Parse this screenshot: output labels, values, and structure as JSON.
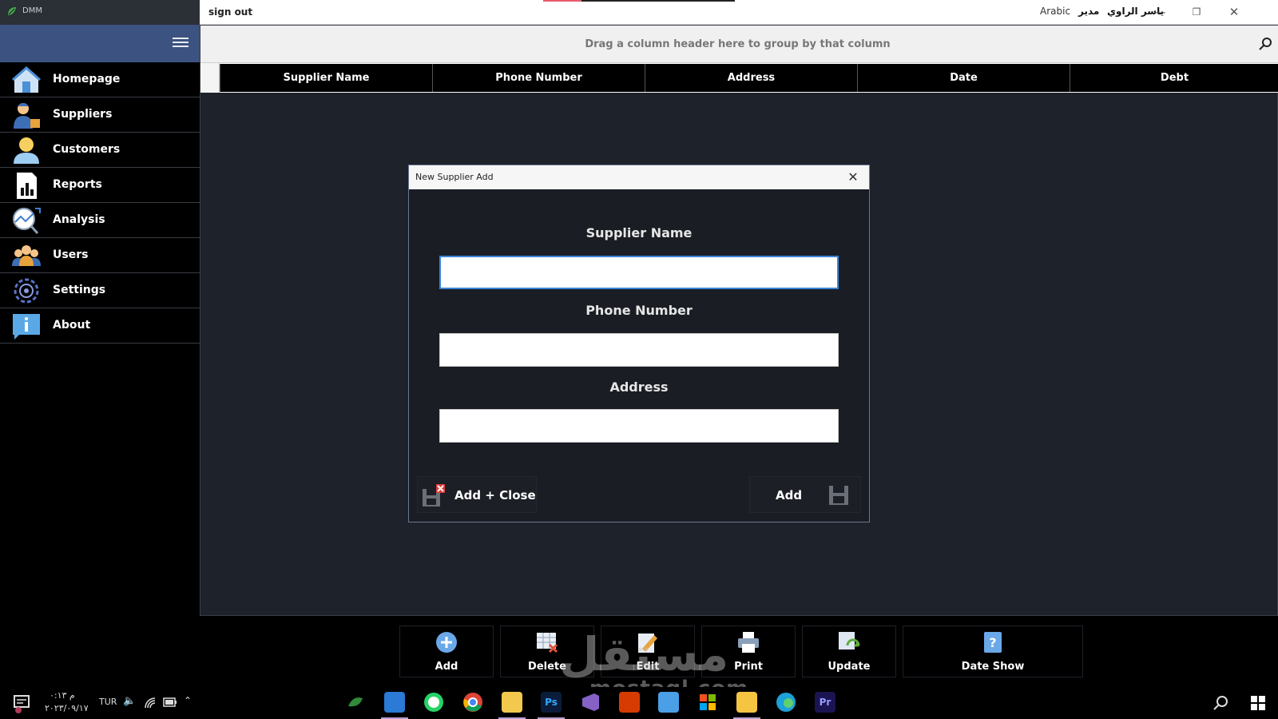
{
  "window": {
    "title": "DMM",
    "sign_out": "sign out",
    "language": "Arabic",
    "role": "مدير",
    "user": "ياسر الراوي",
    "controls": [
      "minimize-icon",
      "restore-icon",
      "close-icon"
    ]
  },
  "sidebar": {
    "items": [
      {
        "label": "Homepage",
        "icon": "home-icon"
      },
      {
        "label": "Suppliers",
        "icon": "supplier-icon"
      },
      {
        "label": "Customers",
        "icon": "customer-icon"
      },
      {
        "label": "Reports",
        "icon": "report-icon"
      },
      {
        "label": "Analysis",
        "icon": "analysis-icon"
      },
      {
        "label": "Users",
        "icon": "users-icon"
      },
      {
        "label": "Settings",
        "icon": "settings-icon"
      },
      {
        "label": "About",
        "icon": "info-icon"
      }
    ]
  },
  "grid": {
    "group_hint": "Drag a column header here to group by that column",
    "columns": [
      "Supplier Name",
      "Phone Number",
      "Address",
      "Date",
      "Debt"
    ]
  },
  "dialog": {
    "title": "New Supplier Add",
    "fields": [
      {
        "label": "Supplier Name",
        "value": ""
      },
      {
        "label": "Phone Number",
        "value": ""
      },
      {
        "label": "Address",
        "value": ""
      }
    ],
    "add_close_label": "Add + Close",
    "add_label": "Add"
  },
  "toolbar": {
    "buttons": [
      {
        "label": "Add",
        "icon": "add-circle-icon"
      },
      {
        "label": "Delete",
        "icon": "delete-table-icon"
      },
      {
        "label": "Edit",
        "icon": "edit-icon"
      },
      {
        "label": "Print",
        "icon": "printer-icon"
      },
      {
        "label": "Update",
        "icon": "refresh-icon"
      },
      {
        "label": "Date Show",
        "icon": "calendar-help-icon"
      }
    ]
  },
  "watermark": {
    "arabic": "مستقل",
    "latin": "mostaql.com"
  },
  "taskbar": {
    "time": "م ٠:١٣",
    "date": "٢٠٢٣/٠٩/١٧",
    "keyboard": "TUR",
    "apps": [
      "mouse-app-icon",
      "media-player-icon",
      "whatsapp-icon",
      "chrome-icon",
      "sticky-app-icon",
      "photoshop-icon",
      "visual-studio-icon",
      "office-icon",
      "mail-icon",
      "store-icon",
      "file-explorer-icon",
      "edge-icon",
      "premiere-icon"
    ]
  },
  "colors": {
    "sidebar_header": "#3c5280",
    "accent_input": "#3a84d8",
    "background": "#1e222b"
  }
}
